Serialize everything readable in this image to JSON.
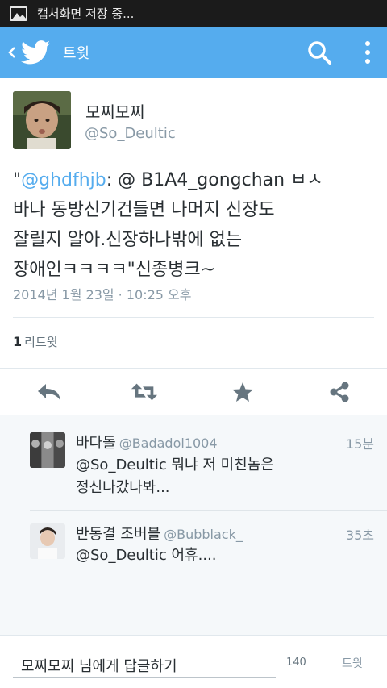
{
  "status_bar": {
    "text": "캡처화면 저장 중...",
    "icon": "image-icon"
  },
  "action_bar": {
    "title": "트윗",
    "color": "#55acee",
    "icons": [
      "back-arrow-icon",
      "twitter-bird-icon",
      "search-icon",
      "overflow-menu-icon"
    ]
  },
  "tweet": {
    "display_name": "모찌모찌",
    "handle": "@So_Deultic",
    "text_open_quote": "\"",
    "text_mention": "@ghdfhjb",
    "text_line1_rest": ": @ B1A4_gongchan ㅂㅅ",
    "text_line2": "바나 동방신기건들면 나머지 신장도",
    "text_line3": "잘릴지 알아.신장하나밖에 없는",
    "text_line4": "장애인ㅋㅋㅋㅋ\"신종병크~",
    "timestamp": "2014년 1월 23일 · 10:25 오후",
    "retweet_count": "1",
    "retweet_label": "리트윗",
    "actions": [
      "reply-icon",
      "retweet-icon",
      "favorite-star-icon",
      "share-icon"
    ]
  },
  "replies": [
    {
      "name": "바다돌",
      "handle": "@Badadol1004",
      "time": "15분",
      "mention": "@So_Deultic",
      "line1": " 뭐냐 저 미친놈은",
      "line2": "정신나갔나봐..."
    },
    {
      "name": "반동결 조버블",
      "handle": "@Bubblack_",
      "time": "35초",
      "mention": "@So_Deultic",
      "line1": " 어휴....",
      "line2": ""
    }
  ],
  "composer": {
    "placeholder": "모찌모찌 님에게 답글하기",
    "char_count": "140",
    "send_label": "트윗"
  }
}
